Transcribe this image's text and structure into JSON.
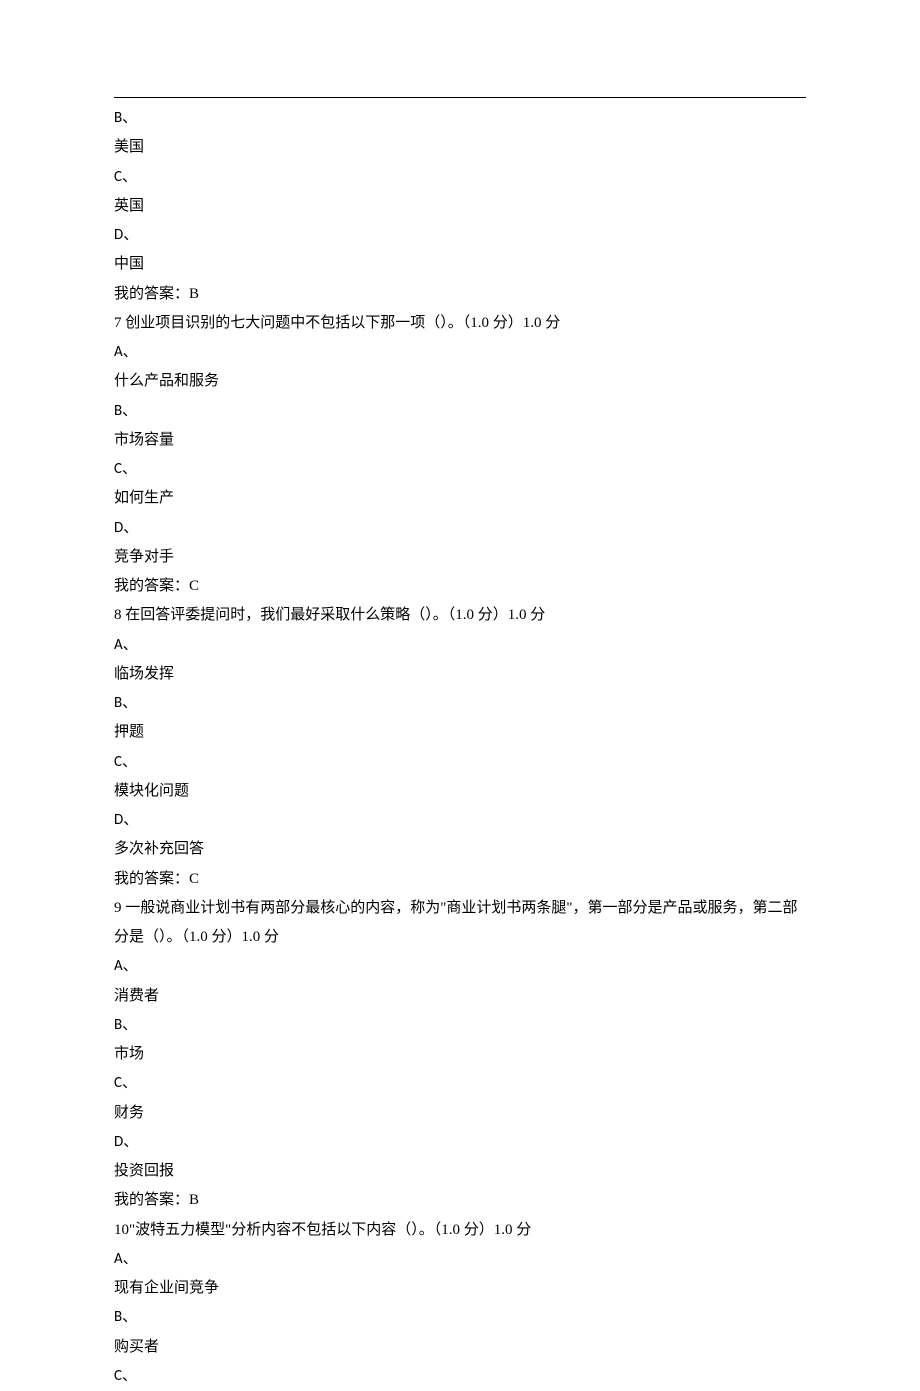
{
  "lines": [
    {
      "text": "B、",
      "latin": true
    },
    {
      "text": "美国"
    },
    {
      "text": "C、",
      "latin": true
    },
    {
      "text": "英国"
    },
    {
      "text": "D、",
      "latin": true
    },
    {
      "text": "中国"
    },
    {
      "text": "我的答案：B"
    },
    {
      "text": "7 创业项目识别的七大问题中不包括以下那一项（）。（1.0 分）1.0 分"
    },
    {
      "text": "A、",
      "latin": true
    },
    {
      "text": "什么产品和服务"
    },
    {
      "text": "B、",
      "latin": true
    },
    {
      "text": "市场容量"
    },
    {
      "text": "C、",
      "latin": true
    },
    {
      "text": "如何生产"
    },
    {
      "text": "D、",
      "latin": true
    },
    {
      "text": "竞争对手"
    },
    {
      "text": "我的答案：C"
    },
    {
      "text": "8 在回答评委提问时，我们最好采取什么策略（）。（1.0 分）1.0 分"
    },
    {
      "text": "A、",
      "latin": true
    },
    {
      "text": "临场发挥"
    },
    {
      "text": "B、",
      "latin": true
    },
    {
      "text": "押题"
    },
    {
      "text": "C、",
      "latin": true
    },
    {
      "text": "模块化问题"
    },
    {
      "text": "D、",
      "latin": true
    },
    {
      "text": "多次补充回答"
    },
    {
      "text": "我的答案：C"
    },
    {
      "text": "9 一般说商业计划书有两部分最核心的内容，称为\"商业计划书两条腿\"，第一部分是产品或服务，第二部分是（）。（1.0 分）1.0 分"
    },
    {
      "text": "A、",
      "latin": true
    },
    {
      "text": "消费者"
    },
    {
      "text": "B、",
      "latin": true
    },
    {
      "text": "市场"
    },
    {
      "text": "C、",
      "latin": true
    },
    {
      "text": "财务"
    },
    {
      "text": "D、",
      "latin": true
    },
    {
      "text": "投资回报"
    },
    {
      "text": "我的答案：B"
    },
    {
      "text": "10\"波特五力模型\"分析内容不包括以下内容（）。（1.0 分）1.0 分"
    },
    {
      "text": "A、",
      "latin": true
    },
    {
      "text": "现有企业间竞争"
    },
    {
      "text": "B、",
      "latin": true
    },
    {
      "text": "购买者"
    },
    {
      "text": "C、",
      "latin": true
    }
  ]
}
